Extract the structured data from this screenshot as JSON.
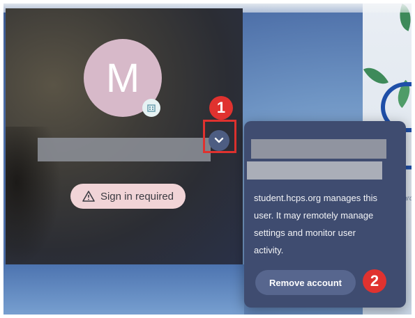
{
  "avatar": {
    "initial": "M"
  },
  "user": {
    "status_label": "Sign in required"
  },
  "menu": {
    "managed_notice": "student.hcps.org manages this user. It may remotely manage settings and monitor user activity.",
    "remove_label": "Remove account"
  },
  "annotations": {
    "step1": "1",
    "step2": "2"
  },
  "wallpaper": {
    "logo_letter": "H",
    "logo_small": "ard"
  },
  "colors": {
    "annotation": "#e0322f",
    "menu_bg": "#3f4c70",
    "avatar_bg": "#d7b9c9",
    "pill_bg": "#f1d4d7"
  }
}
